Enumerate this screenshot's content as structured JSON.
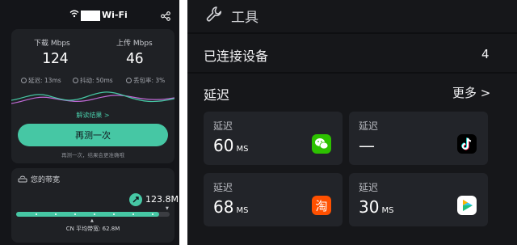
{
  "left": {
    "status_bar": {
      "ssid_suffix": "Wi-Fi"
    },
    "speed": {
      "download_label": "下载 Mbps",
      "download_value": "124",
      "upload_label": "上传 Mbps",
      "upload_value": "46"
    },
    "metrics": [
      {
        "text": "延迟: 13ms"
      },
      {
        "text": "抖动: 50ms"
      },
      {
        "text": "丢包率: 3%"
      }
    ],
    "read_result": "解读结果 >",
    "retest_button": "再测一次",
    "retest_hint": "再测一次，结果会更准确哦",
    "bandwidth": {
      "title": "您的带宽",
      "value": "123.8M",
      "avg_label": "CN 平均带宽: 62.8M",
      "fill_fraction": 0.93
    },
    "colors": {
      "accent": "#46c7a4",
      "download_line": "#46c7a4",
      "upload_line": "#c06ad6"
    }
  },
  "right": {
    "tools_title": "工具",
    "connected_label": "已连接设备",
    "connected_count": "4",
    "latency_title": "延迟",
    "more_label": "更多 >",
    "tiles": [
      {
        "label": "延迟",
        "value": "60",
        "unit": "MS",
        "icon": "wechat-icon"
      },
      {
        "label": "延迟",
        "value": "—",
        "unit": "",
        "icon": "tiktok-icon"
      },
      {
        "label": "延迟",
        "value": "68",
        "unit": "MS",
        "icon": "taobao-icon"
      },
      {
        "label": "延迟",
        "value": "30",
        "unit": "MS",
        "icon": "video-play-icon"
      }
    ],
    "icon_glyphs": {
      "taobao": "淘"
    }
  }
}
